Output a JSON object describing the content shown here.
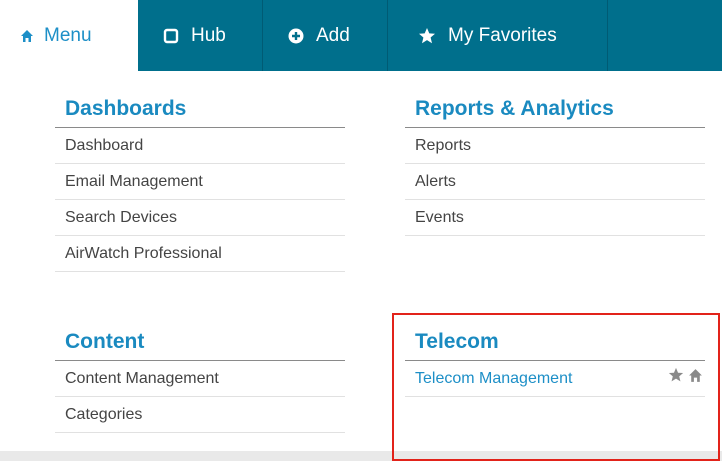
{
  "nav": {
    "tabs": [
      {
        "label": "Menu",
        "icon": "home-icon"
      },
      {
        "label": "Hub",
        "icon": "square-icon"
      },
      {
        "label": "Add",
        "icon": "plus-circle-icon"
      },
      {
        "label": "My Favorites",
        "icon": "star-icon"
      }
    ]
  },
  "sections": {
    "dashboards": {
      "title": "Dashboards",
      "items": [
        "Dashboard",
        "Email Management",
        "Search Devices",
        "AirWatch Professional"
      ]
    },
    "reports": {
      "title": "Reports & Analytics",
      "items": [
        "Reports",
        "Alerts",
        "Events"
      ]
    },
    "content": {
      "title": "Content",
      "items": [
        "Content Management",
        "Categories"
      ]
    },
    "telecom": {
      "title": "Telecom",
      "items": [
        "Telecom Management"
      ]
    }
  },
  "colors": {
    "nav_bg": "#006f8c",
    "accent": "#1a8ac0",
    "highlight": "#e2231a"
  }
}
